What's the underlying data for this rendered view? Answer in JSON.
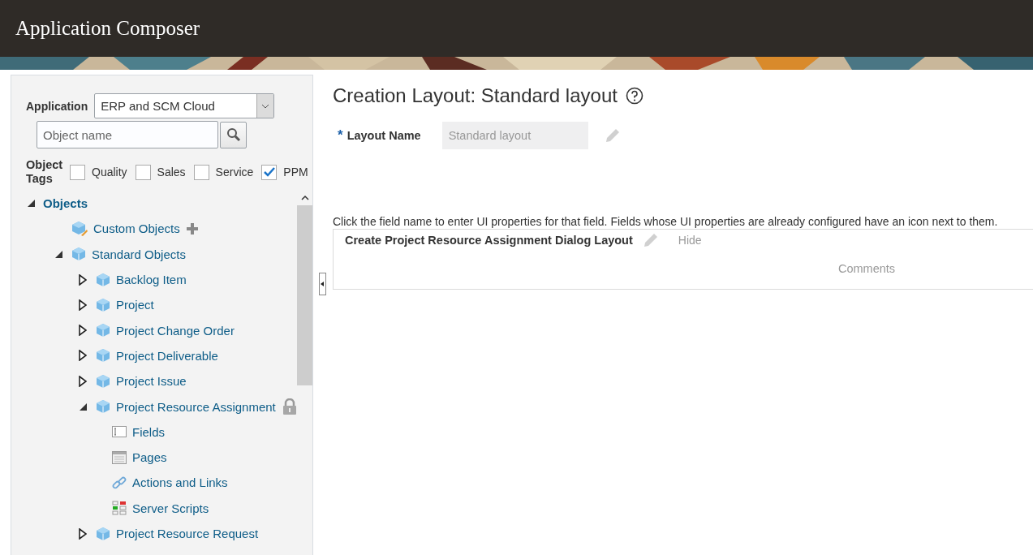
{
  "header": {
    "title": "Application Composer"
  },
  "sidebar": {
    "application_label": "Application",
    "application_value": "ERP and SCM Cloud",
    "search": {
      "placeholder": "Object name"
    },
    "tags_label": "Object Tags",
    "tags": [
      {
        "label": "Quality",
        "checked": false
      },
      {
        "label": "Sales",
        "checked": false
      },
      {
        "label": "Service",
        "checked": false
      },
      {
        "label": "PPM",
        "checked": true
      }
    ],
    "tree": [
      {
        "label": "Objects",
        "kind": "root",
        "expanded": true,
        "children": [
          {
            "label": "Custom Objects",
            "kind": "custom"
          },
          {
            "label": "Standard Objects",
            "kind": "object",
            "expanded": true,
            "children": [
              {
                "label": "Backlog Item",
                "kind": "object",
                "expanded": false
              },
              {
                "label": "Project",
                "kind": "object",
                "expanded": false
              },
              {
                "label": "Project Change Order",
                "kind": "object",
                "expanded": false
              },
              {
                "label": "Project Deliverable",
                "kind": "object",
                "expanded": false
              },
              {
                "label": "Project Issue",
                "kind": "object",
                "expanded": false
              },
              {
                "label": "Project Resource Assignment",
                "kind": "object",
                "expanded": true,
                "locked": true,
                "children": [
                  {
                    "label": "Fields",
                    "kind": "fields"
                  },
                  {
                    "label": "Pages",
                    "kind": "pages"
                  },
                  {
                    "label": "Actions and Links",
                    "kind": "links"
                  },
                  {
                    "label": "Server Scripts",
                    "kind": "scripts"
                  }
                ]
              },
              {
                "label": "Project Resource Request",
                "kind": "object",
                "expanded": false
              }
            ]
          }
        ]
      }
    ]
  },
  "main": {
    "title": "Creation Layout: Standard layout",
    "layout_name_label": "Layout Name",
    "required_mark": "*",
    "layout_name_value": "Standard layout",
    "instructions": "Click the field name to enter UI properties for that field. Fields whose UI properties are already configured have an icon next to them.",
    "region": {
      "title": "Create Project Resource Assignment Dialog Layout",
      "hide_link": "Hide",
      "field": "Comments"
    }
  }
}
